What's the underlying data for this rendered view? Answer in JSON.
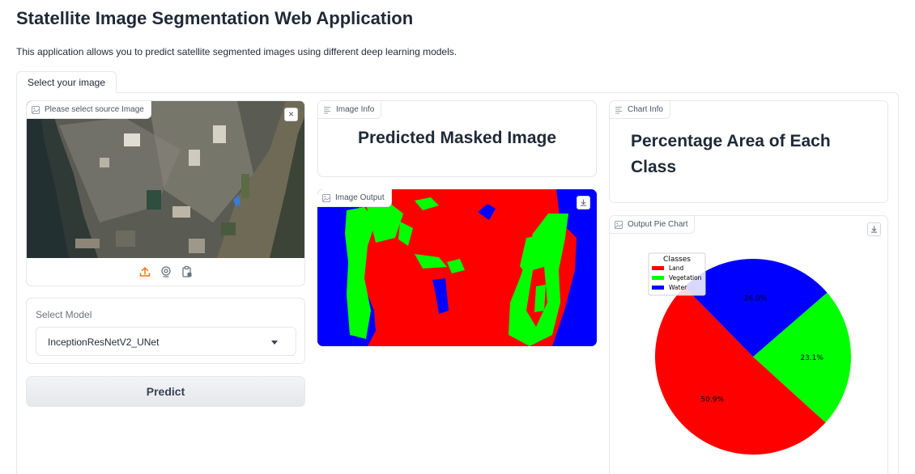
{
  "app": {
    "title": "Statellite Image Segmentation Web Application",
    "description": "This application allows you to predict satellite segmented images using different deep learning models."
  },
  "tabs": [
    {
      "label": "Select your image",
      "selected": true
    }
  ],
  "source_image": {
    "label": "Please select source Image",
    "close_symbol": "×",
    "tools": [
      "upload-icon",
      "webcam-icon",
      "clipboard-icon"
    ],
    "accent_color": "#f97316"
  },
  "model_select": {
    "label": "Select Model",
    "value": "InceptionResNetV2_UNet"
  },
  "predict_button": {
    "label": "Predict"
  },
  "image_info": {
    "label": "Image Info",
    "heading": "Predicted Masked Image"
  },
  "image_output": {
    "label": "Image Output"
  },
  "chart_info": {
    "label": "Chart Info",
    "heading": "Percentage Area of Each Class"
  },
  "pie_block": {
    "label": "Output Pie Chart"
  },
  "chart_data": {
    "type": "pie",
    "legend_title": "Classes",
    "legend_position": "top-left",
    "slices": [
      {
        "name": "Land",
        "value": 50.9,
        "label": "50.9%",
        "color": "#ff0000"
      },
      {
        "name": "Vegetation",
        "value": 23.1,
        "label": "23.1%",
        "color": "#00ff00"
      },
      {
        "name": "Water",
        "value": 26.0,
        "label": "26.0%",
        "color": "#0000ff"
      }
    ]
  }
}
